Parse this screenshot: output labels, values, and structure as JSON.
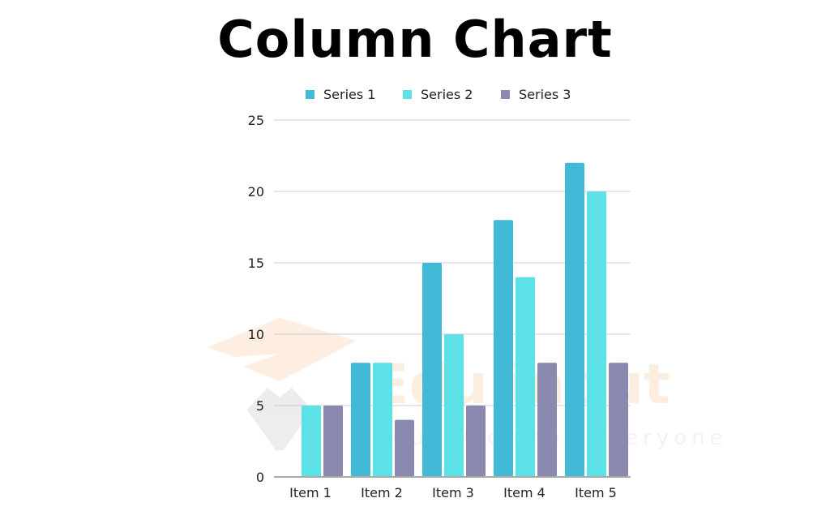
{
  "chart_data": {
    "type": "bar",
    "title": "Column Chart",
    "categories": [
      "Item 1",
      "Item 2",
      "Item 3",
      "Item 4",
      "Item 5"
    ],
    "series": [
      {
        "name": "Series 1",
        "color": "#42b9d6",
        "values": [
          0,
          8,
          15,
          18,
          22
        ]
      },
      {
        "name": "Series 2",
        "color": "#5ce1e6",
        "values": [
          5,
          8,
          10,
          14,
          20
        ]
      },
      {
        "name": "Series 3",
        "color": "#8a89b0",
        "values": [
          5,
          4,
          5,
          8,
          8
        ]
      }
    ],
    "xlabel": "",
    "ylabel": "",
    "ylim": [
      0,
      25
    ],
    "yticks": [
      0,
      5,
      10,
      15,
      20,
      25
    ],
    "grid": true,
    "legend_position": "top-center"
  },
  "watermark": {
    "text": "Edu input",
    "subtitle": "Education for everyone"
  }
}
